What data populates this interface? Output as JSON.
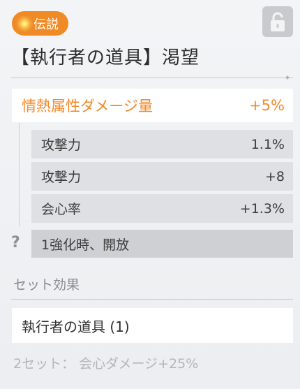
{
  "badge": {
    "label": "伝説",
    "color": "#f08a25"
  },
  "item": {
    "title": "【執行者の道具】渇望"
  },
  "main_stat": {
    "name": "情熱属性ダメージ量",
    "value": "+5%",
    "color": "#f28a2a"
  },
  "sub_stats": [
    {
      "name": "攻撃力",
      "value": "1.1%"
    },
    {
      "name": "攻撃力",
      "value": "+8"
    },
    {
      "name": "会心率",
      "value": "+1.3%"
    }
  ],
  "locked_stat": {
    "icon": "question-icon",
    "text": "1強化時、開放"
  },
  "set_effect": {
    "heading": "セット効果",
    "set_name": "執行者の道具 (1)",
    "bonus": "2セット： 会心ダメージ+25%"
  },
  "icons": {
    "lock": "unlocked-padlock-icon"
  }
}
